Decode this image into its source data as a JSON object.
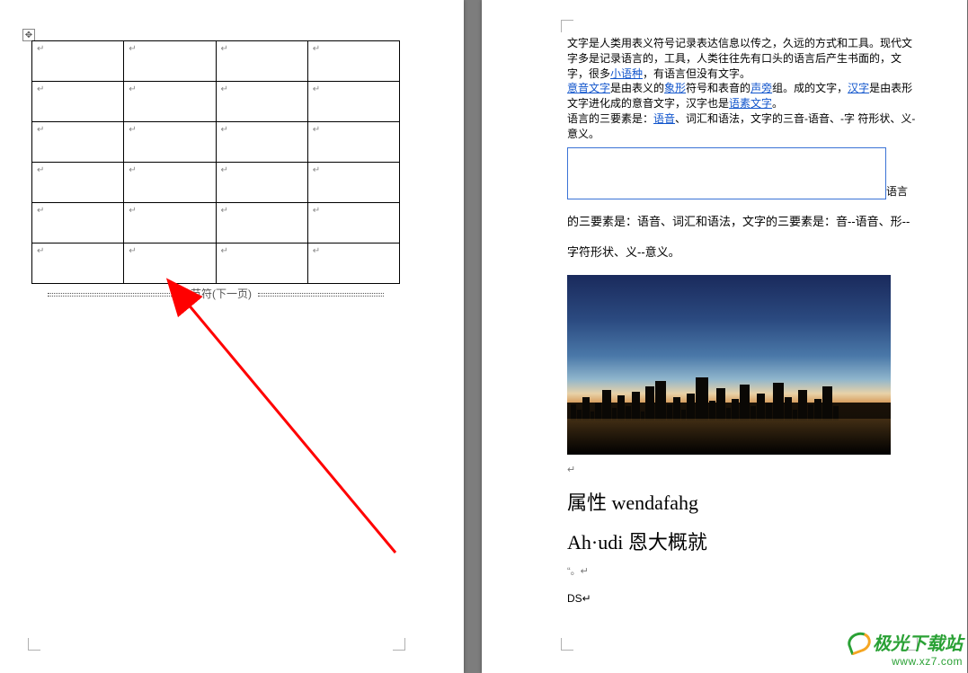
{
  "leftPage": {
    "moveHandleGlyph": "✥",
    "cellMark": "↵",
    "sectionBreakLabel": "分节符(下一页)"
  },
  "rightPage": {
    "para1_a": "文字是人类用表义符号记录表达信息以传之，久远的方式和工具。现代文字多是记录语言的，工具，人类往往先有口头的语言后产生书面的，文字，很多",
    "link1": "小语种",
    "para1_b": "，有语言但没有文字。",
    "link2": "意音文字",
    "para2_a": "是由表义的",
    "link3": "象形",
    "para2_b": "符号和表音的",
    "link4": "声旁",
    "para2_c": "组。成的文字，",
    "link5": "汉字",
    "para2_d": "是由表形文字进化成的意音文字，汉字也是",
    "link6": "语素文字",
    "para2_e": "。",
    "para3_a": "语言的三要素是：",
    "link7": "语音",
    "para3_b": "、词汇和语法，文字的三音-语音、-字 符形状、义-意义。",
    "afterBox": "语言",
    "spaced1": "的三要素是：语音、词汇和语法，文字的三要素是：音--语音、形--",
    "spaced2": "字符形状、义--意义。",
    "paraMark": "↵",
    "heading1": " 属性 wendafahg",
    "heading2": "Ah·udi 恩大概就",
    "smallMark": "“。↵",
    "dsLine": "DS↵"
  },
  "watermark": {
    "title": "极光下载站",
    "url": "www.xz7.com"
  }
}
